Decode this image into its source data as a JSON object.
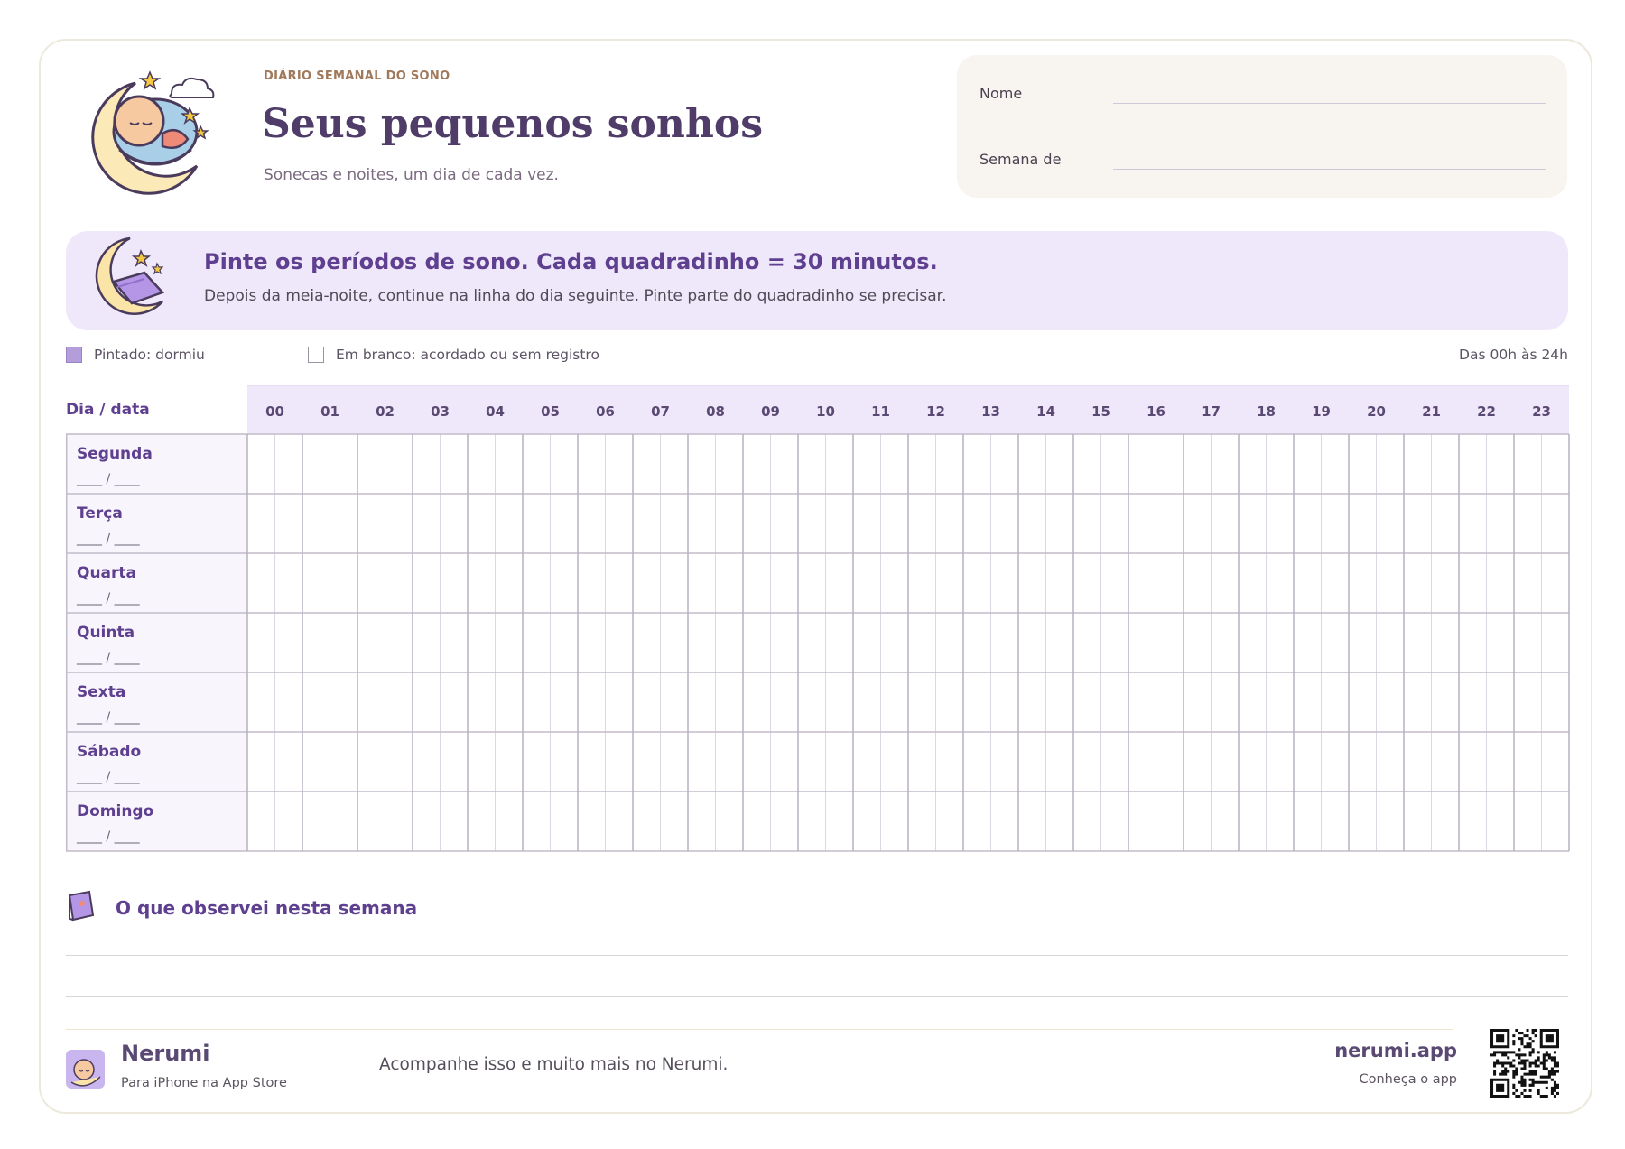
{
  "header": {
    "kicker": "DIÁRIO SEMANAL DO SONO",
    "title": "Seus pequenos sonhos",
    "subtitle": "Sonecas e noites, um dia de cada vez."
  },
  "form": {
    "name_label": "Nome",
    "week_label": "Semana de"
  },
  "banner": {
    "title": "Pinte os períodos de sono. Cada quadradinho = 30 minutos.",
    "text": "Depois da meia-noite, continue na linha do dia seguinte. Pinte parte do quadradinho se precisar."
  },
  "legend": {
    "filled": "Pintado: dormiu",
    "blank": "Em branco: acordado ou sem registro",
    "range": "Das 00h às 24h",
    "filled_color": "#b39ddb"
  },
  "grid": {
    "corner_label": "Dia / data",
    "hours": [
      "00",
      "01",
      "02",
      "03",
      "04",
      "05",
      "06",
      "07",
      "08",
      "09",
      "10",
      "11",
      "12",
      "13",
      "14",
      "15",
      "16",
      "17",
      "18",
      "19",
      "20",
      "21",
      "22",
      "23"
    ],
    "days": [
      {
        "name": "Segunda",
        "date": "____ / ____"
      },
      {
        "name": "Terça",
        "date": "____ / ____"
      },
      {
        "name": "Quarta",
        "date": "____ / ____"
      },
      {
        "name": "Quinta",
        "date": "____ / ____"
      },
      {
        "name": "Sexta",
        "date": "____ / ____"
      },
      {
        "name": "Sábado",
        "date": "____ / ____"
      },
      {
        "name": "Domingo",
        "date": "____ / ____"
      }
    ]
  },
  "notes": {
    "title": "O que observei nesta semana"
  },
  "footer": {
    "brand": "Nerumi",
    "brand_sub": "Para iPhone na App Store",
    "message": "Acompanhe isso e muito mais no Nerumi.",
    "site": "nerumi.app",
    "site_sub": "Conheça o app"
  },
  "icons": {
    "header": "baby-sleeping-on-moon-icon",
    "banner": "moon-with-blanket-icon",
    "notes": "notebook-icon",
    "footer_logo": "nerumi-logo-icon",
    "qr": "qr-code-icon"
  }
}
